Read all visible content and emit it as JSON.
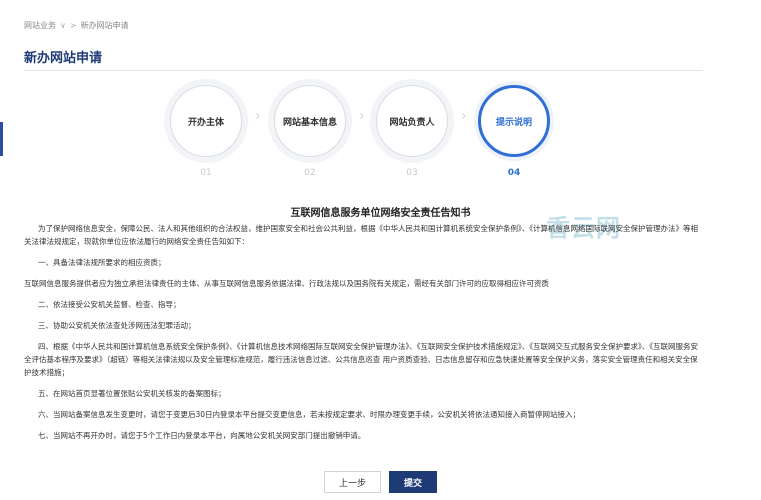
{
  "breadcrumb": {
    "root": "网站业务",
    "current": "新办网站申请"
  },
  "page_title": "新办网站申请",
  "steps": [
    {
      "label": "开办主体",
      "number": "01",
      "active": false
    },
    {
      "label": "网站基本信息",
      "number": "02",
      "active": false
    },
    {
      "label": "网站负责人",
      "number": "03",
      "active": false
    },
    {
      "label": "提示说明",
      "number": "04",
      "active": true
    }
  ],
  "notice": {
    "title": "互联网信息服务单位网络安全责任告知书",
    "paragraphs": [
      "为了保护网络信息安全，保障公民、法人和其他组织的合法权益，维护国家安全和社会公共利益，根据《中华人民共和国计算机系统安全保护条例》、《计算机信息网络国际联网安全保护管理办法》等相关法律法规规定，现就你单位应依法履行的网络安全责任告知如下：",
      "一、具备法律法规所要求的相应资质；",
      "互联网信息服务提供者应为独立承担法律责任的主体、从事互联网信息服务依据法律、行政法规以及国务院有关规定，需经有关部门许可的应取得相应许可资质",
      "二、依法接受公安机关监督、检查、指导；",
      "三、协助公安机关依法查处涉网违法犯罪活动；",
      "四、根据《中华人民共和国计算机信息系统安全保护条例》、《计算机信息技术网络国际互联网安全保护管理办法》、《互联网安全保护技术措施规定》、《互联网交互式服务安全保护要求》、《互联网服务安全评估基本程序及要求》（超链）等相关法律法规以及安全管理标准规范，履行违法信息过滤、公共信息巡查 用户资质查验、日志信息留存和应急快速处置等安全保护义务，落实安全管理责任和相关安全保护技术措施；",
      "五、在网站首页显著位置张贴公安机关核发的备案图标；",
      "六、当网站备案信息发生变更时，请您于变更后30日内登录本平台提交变更信息，若未按规定要求、时限办理变更手续，公安机关将依法通知接入商暂停网站接入；",
      "七、当网站不再开办时，请您于5个工作日内登录本平台，向属地公安机关网安部门提出撤销申请。"
    ]
  },
  "watermark": "香云网",
  "buttons": {
    "prev": "上一步",
    "submit": "提交"
  },
  "colors": {
    "primary": "#1f3b76",
    "accent": "#2f6fd6"
  }
}
